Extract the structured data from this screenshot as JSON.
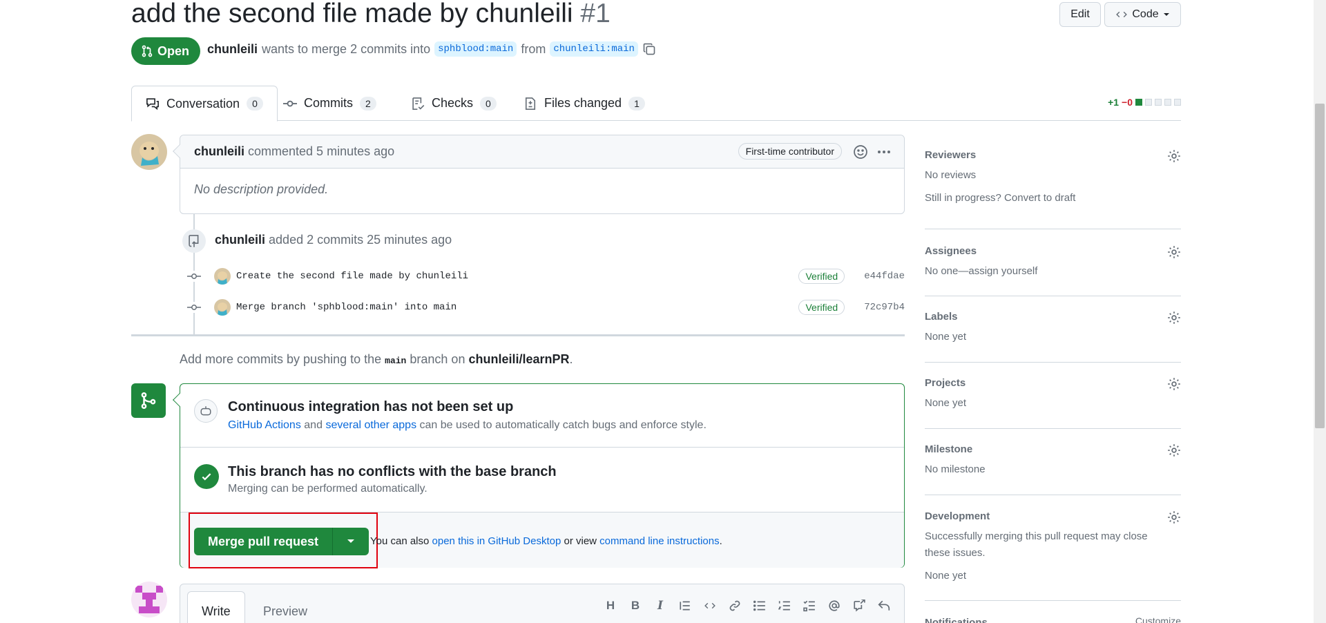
{
  "pr": {
    "title": "add the second file made by chunleili",
    "number": "#1",
    "state": "Open",
    "author": "chunleili",
    "meta_text": "wants to merge 2 commits into",
    "base_branch": "sphblood:main",
    "from_text": "from",
    "head_branch": "chunleili:main"
  },
  "header_buttons": {
    "edit": "Edit",
    "code": "Code"
  },
  "tabs": [
    {
      "label": "Conversation",
      "count": "0"
    },
    {
      "label": "Commits",
      "count": "2"
    },
    {
      "label": "Checks",
      "count": "0"
    },
    {
      "label": "Files changed",
      "count": "1"
    }
  ],
  "diffstat": {
    "additions": "+1",
    "deletions": "−0"
  },
  "comment": {
    "author": "chunleili",
    "action": "commented 5 minutes ago",
    "badge": "First-time contributor",
    "body": "No description provided."
  },
  "commit_event": {
    "author": "chunleili",
    "action": "added 2 commits 25 minutes ago"
  },
  "commits": [
    {
      "message": "Create the second file made by chunleili",
      "badge": "Verified",
      "sha": "e44fdae"
    },
    {
      "message": "Merge branch 'sphblood:main' into main",
      "badge": "Verified",
      "sha": "72c97b4"
    }
  ],
  "add_more": {
    "prefix": "Add more commits by pushing to the",
    "branch": "main",
    "middle": "branch on",
    "repo": "chunleili/learnPR",
    "suffix": "."
  },
  "merge_box": {
    "ci_title": "Continuous integration has not been set up",
    "ci_link1": "GitHub Actions",
    "ci_and": "and",
    "ci_link2": "several other apps",
    "ci_rest": "can be used to automatically catch bugs and enforce style.",
    "conflict_title": "This branch has no conflicts with the base branch",
    "conflict_sub": "Merging can be performed automatically.",
    "merge_button": "Merge pull request",
    "alt_prefix": "You can also",
    "alt_link1": "open this in GitHub Desktop",
    "alt_mid": "or view",
    "alt_link2": "command line instructions",
    "alt_suffix": "."
  },
  "write": {
    "write_tab": "Write",
    "preview_tab": "Preview"
  },
  "sidebar": {
    "reviewers": {
      "label": "Reviewers",
      "value": "No reviews",
      "extra": "Still in progress? Convert to draft"
    },
    "assignees": {
      "label": "Assignees",
      "value": "No one—assign yourself"
    },
    "labels": {
      "label": "Labels",
      "value": "None yet"
    },
    "projects": {
      "label": "Projects",
      "value": "None yet"
    },
    "milestone": {
      "label": "Milestone",
      "value": "No milestone"
    },
    "development": {
      "label": "Development",
      "value": "Successfully merging this pull request may close these issues.",
      "extra": "None yet"
    },
    "notifications": {
      "label": "Notifications",
      "action": "Customize"
    }
  },
  "colors": {
    "green": "#1f883d",
    "link": "#0969da",
    "highlight": "#e0000e"
  }
}
